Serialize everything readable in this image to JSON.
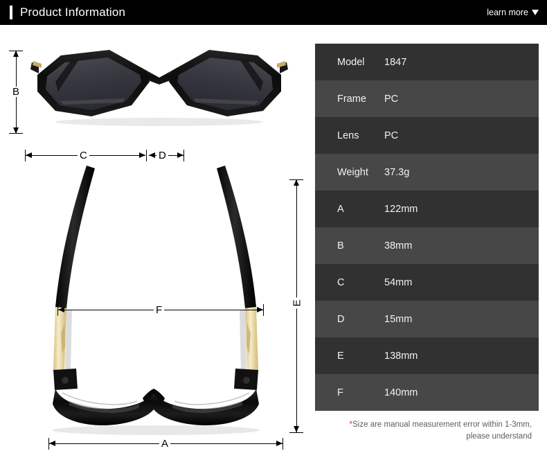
{
  "header": {
    "title": "Product Information",
    "learn_more_label": "learn more",
    "caret_icon": "chevron-down-icon"
  },
  "diagram": {
    "front_view_alt": "sunglasses-front-view",
    "top_view_alt": "sunglasses-top-view",
    "labels": {
      "b": "B",
      "c": "C",
      "d": "D",
      "e": "E",
      "f": "F",
      "a": "A"
    }
  },
  "spec_table": {
    "rows": [
      {
        "key": "Model",
        "value": "1847"
      },
      {
        "key": "Frame",
        "value": "PC"
      },
      {
        "key": "Lens",
        "value": "PC"
      },
      {
        "key": "Weight",
        "value": "37.3g"
      },
      {
        "key": "A",
        "value": "122mm"
      },
      {
        "key": "B",
        "value": "38mm"
      },
      {
        "key": "C",
        "value": "54mm"
      },
      {
        "key": "D",
        "value": "15mm"
      },
      {
        "key": "E",
        "value": "138mm"
      },
      {
        "key": "F",
        "value": "140mm"
      }
    ]
  },
  "note": {
    "star": "*",
    "line1": "Size are manual measurement error within 1-3mm,",
    "line2": "please understand"
  },
  "colors": {
    "header_bg": "#000000",
    "row_dark": "#313131",
    "row_light": "#474747",
    "note_accent": "#ee3322",
    "frame_black": "#141414",
    "lens_gray": "#3a3a42",
    "temple_gold": "#f5e3b8"
  }
}
